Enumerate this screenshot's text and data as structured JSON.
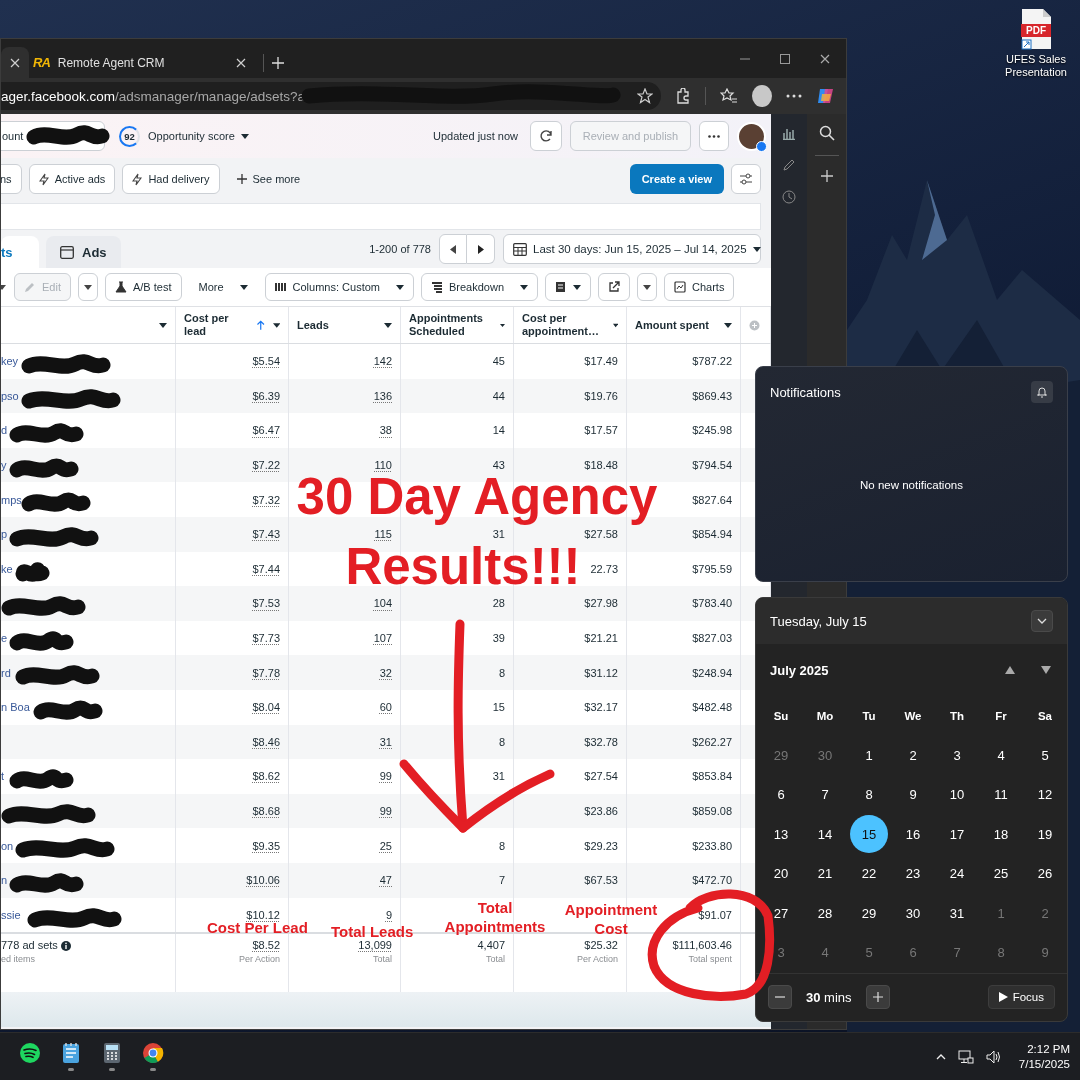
{
  "desktop_icon": {
    "badge": "PDF",
    "label": "UFES Sales Presentation"
  },
  "browser": {
    "tabs": [
      {
        "selected": true
      },
      {
        "logo": "RA",
        "title": "Remote Agent CRM",
        "selected": false
      }
    ],
    "url": "**ager.facebook.com**/adsmanager/manage/adsets?a",
    "header": {
      "account": "ount",
      "score": "92",
      "score_label": "Opportunity score",
      "updated": "Updated just now",
      "review": "Review and publish",
      "review_disabled": true
    },
    "filters": [
      {
        "kind": "chip",
        "label": "ns"
      },
      {
        "kind": "flash-chip",
        "label": "Active ads"
      },
      {
        "kind": "flash-chip",
        "label": "Had delivery"
      },
      {
        "kind": "add",
        "label": "See more"
      }
    ],
    "create_view": "Create a view",
    "level_tabs": [
      {
        "label": "ts",
        "selected": true
      },
      {
        "label": "Ads",
        "selected": false
      }
    ],
    "pagination": "1-200 of 778",
    "date_range": "Last 30 days: Jun 15, 2025 – Jul 14, 2025",
    "toolbar": [
      {
        "kind": "caret"
      },
      {
        "kind": "button",
        "label": "Edit",
        "disabled": true
      },
      {
        "kind": "caret"
      },
      {
        "kind": "button",
        "label": "A/B test",
        "disabled": false
      },
      {
        "kind": "dropdown",
        "label": "More",
        "disabled": false
      },
      {
        "kind": "dropdown",
        "label": "Columns: Custom",
        "disabled": false
      },
      {
        "kind": "dropdown",
        "label": "Breakdown",
        "disabled": false
      },
      {
        "kind": "icon-dropdown"
      },
      {
        "kind": "icon"
      },
      {
        "kind": "caret"
      },
      {
        "kind": "button",
        "label": "Charts",
        "disabled": false
      }
    ],
    "table": {
      "columns": [
        {
          "label": "Cost per lead",
          "sorted": true
        },
        {
          "label": "Leads",
          "sorted": false
        },
        {
          "label": "Appointments Scheduled",
          "sorted": false
        },
        {
          "label": "Cost per appointment…",
          "sorted": false
        },
        {
          "label": "Amount spent",
          "sorted": false
        }
      ],
      "rows": [
        {
          "name": "key",
          "redacted": true,
          "cost_per_lead": "$5.54",
          "leads": "142",
          "appointments": "45",
          "cost_per_appointment": "$17.49",
          "amount_spent": "$787.22"
        },
        {
          "name": "pso",
          "redacted": true,
          "cost_per_lead": "$6.39",
          "leads": "136",
          "appointments": "44",
          "cost_per_appointment": "$19.76",
          "amount_spent": "$869.43"
        },
        {
          "name": "d",
          "redacted": true,
          "cost_per_lead": "$6.47",
          "leads": "38",
          "appointments": "14",
          "cost_per_appointment": "$17.57",
          "amount_spent": "$245.98"
        },
        {
          "name": "y",
          "redacted": true,
          "cost_per_lead": "$7.22",
          "leads": "110",
          "appointments": "43",
          "cost_per_appointment": "$18.48",
          "amount_spent": "$794.54"
        },
        {
          "name": "mps",
          "redacted": true,
          "cost_per_lead": "$7.32",
          "amount_spent": "$827.64"
        },
        {
          "name": "p",
          "redacted": true,
          "cost_per_lead": "$7.43",
          "leads": "115",
          "appointments": "31",
          "cost_per_appointment": "$27.58",
          "amount_spent": "$854.94"
        },
        {
          "name": "ke",
          "redacted": true,
          "cost_per_lead": "$7.44",
          "cost_per_appointment": "22.73",
          "amount_spent": "$795.59"
        },
        {
          "redacted": true,
          "cost_per_lead": "$7.53",
          "leads": "104",
          "appointments": "28",
          "cost_per_appointment": "$27.98",
          "amount_spent": "$783.40"
        },
        {
          "name": "e",
          "redacted": true,
          "cost_per_lead": "$7.73",
          "leads": "107",
          "appointments": "39",
          "cost_per_appointment": "$21.21",
          "amount_spent": "$827.03"
        },
        {
          "name": "rd",
          "redacted": true,
          "cost_per_lead": "$7.78",
          "leads": "32",
          "appointments": "8",
          "cost_per_appointment": "$31.12",
          "amount_spent": "$248.94"
        },
        {
          "name": "n Boa",
          "redacted": true,
          "cost_per_lead": "$8.04",
          "leads": "60",
          "appointments": "15",
          "cost_per_appointment": "$32.17",
          "amount_spent": "$482.48"
        },
        {
          "redacted": false,
          "cost_per_lead": "$8.46",
          "leads": "31",
          "appointments": "8",
          "cost_per_appointment": "$32.78",
          "amount_spent": "$262.27"
        },
        {
          "name": "t",
          "redacted": true,
          "cost_per_lead": "$8.62",
          "leads": "99",
          "appointments": "31",
          "cost_per_appointment": "$27.54",
          "amount_spent": "$853.84"
        },
        {
          "redacted": true,
          "cost_per_lead": "$8.68",
          "leads": "99",
          "cost_per_appointment": "$23.86",
          "amount_spent": "$859.08"
        },
        {
          "name": "on",
          "redacted": true,
          "cost_per_lead": "$9.35",
          "leads": "25",
          "appointments": "8",
          "cost_per_appointment": "$29.23",
          "amount_spent": "$233.80"
        },
        {
          "name": "n",
          "redacted": true,
          "cost_per_lead": "$10.06",
          "leads": "47",
          "appointments": "7",
          "cost_per_appointment": "$67.53",
          "amount_spent": "$472.70"
        },
        {
          "name": "ssie",
          "redacted": true,
          "cost_per_lead": "$10.12",
          "leads": "9",
          "amount_spent": "$91.07"
        }
      ],
      "totals": {
        "label": "778 ad sets",
        "sublabel": "ed items",
        "cells": [
          {
            "value": "$8.52",
            "note": "Per Action"
          },
          {
            "value": "13,099",
            "note": "Total"
          },
          {
            "value": "4,407",
            "note": "Total"
          },
          {
            "value": "$25.32",
            "note": "Per Action"
          },
          {
            "value": "$111,603.46",
            "note": "Total spent"
          }
        ]
      }
    }
  },
  "notifications": {
    "title": "Notifications",
    "empty": "No new notifications"
  },
  "calendar": {
    "date_header": "Tuesday, July 15",
    "month": "July 2025",
    "weekdays": [
      "Su",
      "Mo",
      "Tu",
      "We",
      "Th",
      "Fr",
      "Sa"
    ],
    "days": [
      {
        "label": "29",
        "outside": true,
        "selected": false
      },
      {
        "label": "30",
        "outside": true,
        "selected": false
      },
      {
        "label": "1",
        "outside": false,
        "selected": false
      },
      {
        "label": "2",
        "outside": false,
        "selected": false
      },
      {
        "label": "3",
        "outside": false,
        "selected": false
      },
      {
        "label": "4",
        "outside": false,
        "selected": false
      },
      {
        "label": "5",
        "outside": false,
        "selected": false
      },
      {
        "label": "6",
        "outside": false,
        "selected": false
      },
      {
        "label": "7",
        "outside": false,
        "selected": false
      },
      {
        "label": "8",
        "outside": false,
        "selected": false
      },
      {
        "label": "9",
        "outside": false,
        "selected": false
      },
      {
        "label": "10",
        "outside": false,
        "selected": false
      },
      {
        "label": "11",
        "outside": false,
        "selected": false
      },
      {
        "label": "12",
        "outside": false,
        "selected": false
      },
      {
        "label": "13",
        "outside": false,
        "selected": false
      },
      {
        "label": "14",
        "outside": false,
        "selected": false
      },
      {
        "label": "15",
        "outside": false,
        "selected": true
      },
      {
        "label": "16",
        "outside": false,
        "selected": false
      },
      {
        "label": "17",
        "outside": false,
        "selected": false
      },
      {
        "label": "18",
        "outside": false,
        "selected": false
      },
      {
        "label": "19",
        "outside": false,
        "selected": false
      },
      {
        "label": "20",
        "outside": false,
        "selected": false
      },
      {
        "label": "21",
        "outside": false,
        "selected": false
      },
      {
        "label": "22",
        "outside": false,
        "selected": false
      },
      {
        "label": "23",
        "outside": false,
        "selected": false
      },
      {
        "label": "24",
        "outside": false,
        "selected": false
      },
      {
        "label": "25",
        "outside": false,
        "selected": false
      },
      {
        "label": "26",
        "outside": false,
        "selected": false
      },
      {
        "label": "27",
        "outside": false,
        "selected": false
      },
      {
        "label": "28",
        "outside": false,
        "selected": false
      },
      {
        "label": "29",
        "outside": false,
        "selected": false
      },
      {
        "label": "30",
        "outside": false,
        "selected": false
      },
      {
        "label": "31",
        "outside": false,
        "selected": false
      },
      {
        "label": "1",
        "outside": true,
        "selected": false
      },
      {
        "label": "2",
        "outside": true,
        "selected": false
      },
      {
        "label": "3",
        "outside": true,
        "selected": false
      },
      {
        "label": "4",
        "outside": true,
        "selected": false
      },
      {
        "label": "5",
        "outside": true,
        "selected": false
      },
      {
        "label": "6",
        "outside": true,
        "selected": false
      },
      {
        "label": "7",
        "outside": true,
        "selected": false
      },
      {
        "label": "8",
        "outside": true,
        "selected": false
      },
      {
        "label": "9",
        "outside": true,
        "selected": false
      }
    ],
    "focus": {
      "minutes": "30",
      "unit": "mins",
      "button": "Focus"
    }
  },
  "taskbar": {
    "apps": [
      {
        "running": false
      },
      {
        "running": true
      },
      {
        "running": true
      },
      {
        "running": true
      }
    ],
    "time": "2:12 PM",
    "date": "7/15/2025"
  },
  "annotations": {
    "headline": [
      "30 Day Agency",
      "Results!!!"
    ],
    "labels": [
      "Cost Per Lead",
      "Total Leads",
      "Total Appointments",
      "Appointment Cost"
    ]
  }
}
